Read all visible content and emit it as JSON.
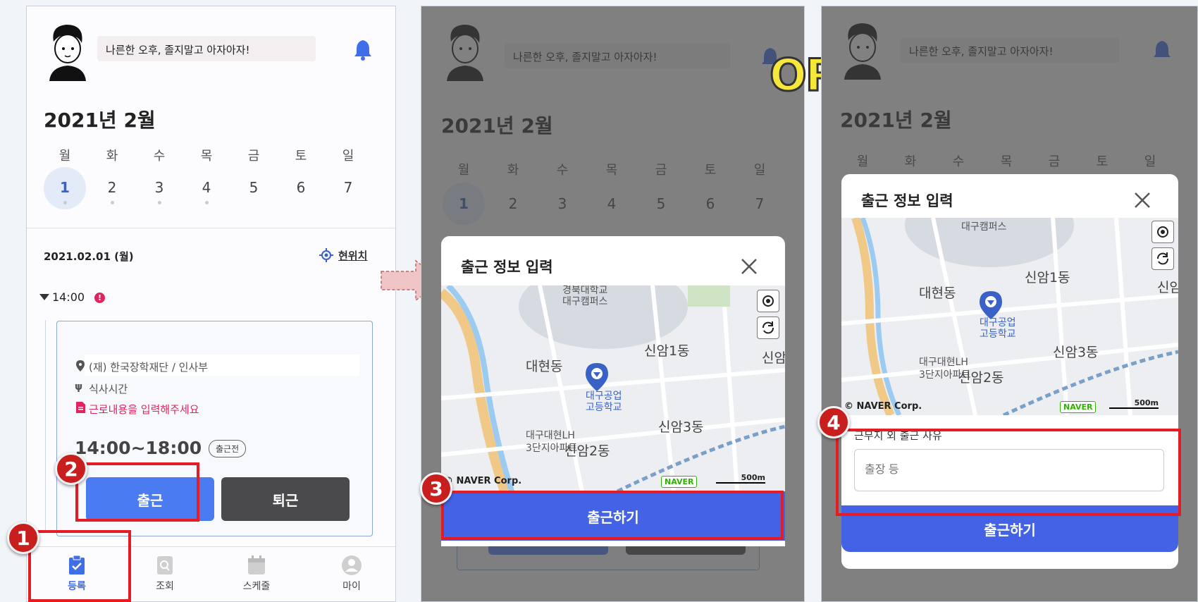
{
  "shared": {
    "greeting": "나른한 오후, 졸지말고 아자아자!",
    "month": "2021년 2월",
    "weekdays": [
      "월",
      "화",
      "수",
      "목",
      "금",
      "토",
      "일"
    ],
    "dates": [
      "1",
      "2",
      "3",
      "4",
      "5",
      "6",
      "7"
    ],
    "modal_title": "출근 정보 입력",
    "submit_label": "출근하기"
  },
  "panel1": {
    "date_label": "2021.02.01 (월)",
    "location_link": "현위치",
    "time_group": "14:00",
    "place": "(재) 한국장학재단 / 인사부",
    "meal": "식사시간",
    "warning": "근로내용을 입력해주세요",
    "shift_time": "14:00~18:00",
    "status_chip": "출근전",
    "checkin_label": "출근",
    "checkout_label": "퇴근",
    "tabs": [
      "등록",
      "조회",
      "스케줄",
      "마이"
    ]
  },
  "map": {
    "labels": [
      "경북대학교",
      "대구캠퍼스",
      "신암1동",
      "대현동",
      "대구공업",
      "고등학교",
      "신암3동",
      "대구대현LH",
      "3단지아파트",
      "신암2동",
      "신암"
    ],
    "copyright": "© NAVER Corp.",
    "naver_logo": "NAVER",
    "scale": "500m"
  },
  "panel3": {
    "reason_label": "근무지 외 출근 사유",
    "reason_placeholder": "출장 등"
  },
  "overlay": {
    "or_text": "OR"
  },
  "steps": [
    "1",
    "2",
    "3",
    "4"
  ],
  "colors": {
    "primary": "#4362e6",
    "highlight": "#e51c23",
    "badge": "#c91e1e",
    "dark_button": "#4a4a4c",
    "or_yellow": "#f6e83a"
  }
}
